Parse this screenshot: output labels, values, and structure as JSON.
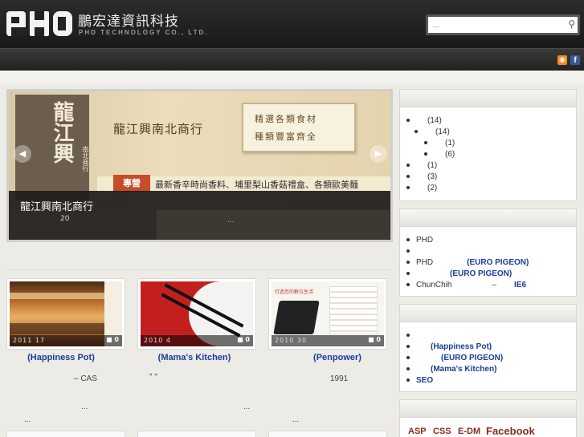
{
  "header": {
    "logo_letters": "PHD",
    "company_name": "鵬宏達資訊科技",
    "company_sub": "PHD TECHNOLOGY CO., LTD.",
    "search_placeholder": "...",
    "search_icon": "magnifier-icon",
    "rss_glyph": "◉",
    "fb_glyph": "f"
  },
  "slider": {
    "sign_text": "龍江興",
    "sign_small": "南北商行",
    "shop_name": "龍江興南北商行",
    "board_line1": "精選各類食材",
    "board_line2": "種類豐富齊全",
    "tag_label": "專營",
    "banner_text": "最新香辛時尚香料、埔里梨山香菇禮盒、各類歐美麵",
    "caption_title": "龍江興南北商行",
    "caption_date": "20",
    "caption_more": "...",
    "prev_glyph": "◀",
    "next_glyph": "▶"
  },
  "cards": [
    {
      "date": "2011    17",
      "comments": "0",
      "title": "(Happiness Pot)",
      "text1": "–          CAS",
      "text2": "...",
      "text3": "..."
    },
    {
      "date": "2010     4",
      "comments": "0",
      "title": "(Mama's Kitchen)",
      "text1": "\"  \"",
      "text2": "...",
      "text3": ""
    },
    {
      "date": "2010     30",
      "comments": "0",
      "title": "(Penpower)",
      "text1": "1991",
      "text2": "...",
      "text3": ""
    }
  ],
  "sidebar": {
    "categories": [
      {
        "label": "(14)",
        "level": 0
      },
      {
        "label": "(14)",
        "level": 1
      },
      {
        "label": "(1)",
        "level": 2
      },
      {
        "label": "(6)",
        "level": 2
      },
      {
        "label": "(1)",
        "level": 0
      },
      {
        "label": "(3)",
        "level": 0
      },
      {
        "label": "(2)",
        "level": 0
      }
    ],
    "recent": [
      {
        "prefix": "PHD",
        "blue": ""
      },
      {
        "prefix": "",
        "blue": ""
      },
      {
        "prefix": "PHD",
        "blue": "(EURO PIGEON)"
      },
      {
        "prefix": "",
        "blue": "(EURO PIGEON)"
      },
      {
        "prefix": "ChunChih",
        "mid": "–",
        "blue": "IE6"
      }
    ],
    "popular": [
      {
        "blue": ""
      },
      {
        "blue": "(Happiness Pot)"
      },
      {
        "blue": "(EURO PIGEON)"
      },
      {
        "blue": "(Mama's Kitchen)"
      },
      {
        "blue": "SEO"
      }
    ],
    "tags": [
      "ASP",
      "CSS",
      "E-DM",
      "Facebook"
    ]
  }
}
